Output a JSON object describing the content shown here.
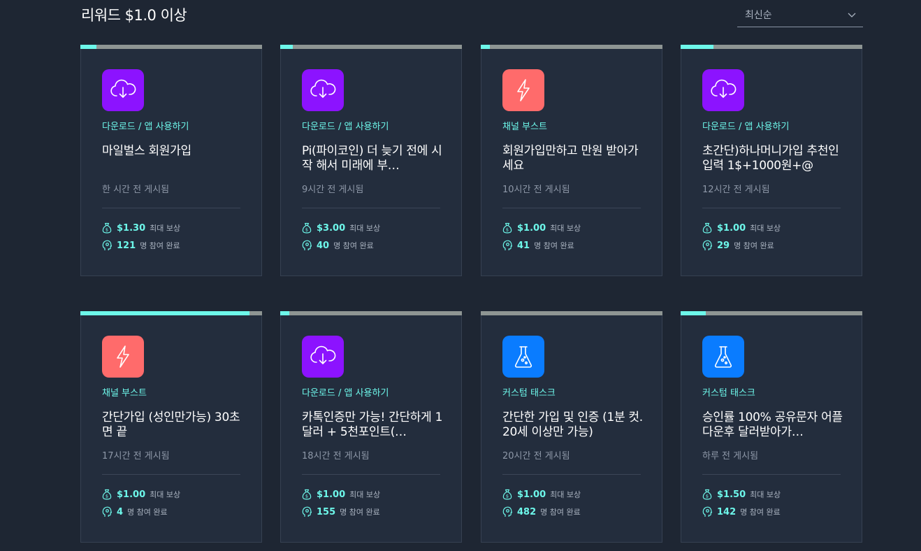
{
  "header": {
    "title": "리워드 $1.0 이상",
    "sort": {
      "selected": "최신순"
    }
  },
  "icons": {
    "download": {
      "name": "cloud-download-icon",
      "color": "#8c13ff"
    },
    "boost": {
      "name": "lightning-icon",
      "color": "#ff6b6b"
    },
    "custom": {
      "name": "flask-icon",
      "color": "#0a7cff"
    }
  },
  "accent_color": "#6df7ea",
  "cards": [
    {
      "icon": "download",
      "category": "다운로드 / 앱 사용하기",
      "title": "마일벌스 회원가입",
      "posted": "한 시간 전 게시됨",
      "reward": "$1.30",
      "reward_label": "최대 보상",
      "participants": "121",
      "participants_label": "명 참여 완료",
      "progress": 0.09
    },
    {
      "icon": "download",
      "category": "다운로드 / 앱 사용하기",
      "title": "Pi(파이코인) 더 늦기 전에 시작 해서 미래에 부…",
      "posted": "9시간 전 게시됨",
      "reward": "$3.00",
      "reward_label": "최대 보상",
      "participants": "40",
      "participants_label": "명 참여 완료",
      "progress": 0.07
    },
    {
      "icon": "boost",
      "category": "채널 부스트",
      "title": "회원가입만하고 만원 받아가세요",
      "posted": "10시간 전 게시됨",
      "reward": "$1.00",
      "reward_label": "최대 보상",
      "participants": "41",
      "participants_label": "명 참여 완료",
      "progress": 0.05
    },
    {
      "icon": "download",
      "category": "다운로드 / 앱 사용하기",
      "title": "초간단)하나머니가입 추천인 입력 1$+1000원+@",
      "posted": "12시간 전 게시됨",
      "reward": "$1.00",
      "reward_label": "최대 보상",
      "participants": "29",
      "participants_label": "명 참여 완료",
      "progress": 0.18
    },
    {
      "icon": "boost",
      "category": "채널 부스트",
      "title": "간단가입 (성인만가능) 30초면 끝",
      "posted": "17시간 전 게시됨",
      "reward": "$1.00",
      "reward_label": "최대 보상",
      "participants": "4",
      "participants_label": "명 참여 완료",
      "progress": 0.93
    },
    {
      "icon": "download",
      "category": "다운로드 / 앱 사용하기",
      "title": "카톡인증만 가능! 간단하게 1달러 + 5천포인트(…",
      "posted": "18시간 전 게시됨",
      "reward": "$1.00",
      "reward_label": "최대 보상",
      "participants": "155",
      "participants_label": "명 참여 완료",
      "progress": 0.05
    },
    {
      "icon": "custom",
      "category": "커스텀 태스크",
      "title": "간단한 가입 및 인증 (1분 컷. 20세 이상만 가능)",
      "posted": "20시간 전 게시됨",
      "reward": "$1.00",
      "reward_label": "최대 보상",
      "participants": "482",
      "participants_label": "명 참여 완료",
      "progress": 0.0
    },
    {
      "icon": "custom",
      "category": "커스텀 태스크",
      "title": "승인률 100% 공유문자 어플다운후 달러받아가…",
      "posted": "하루 전 게시됨",
      "reward": "$1.50",
      "reward_label": "최대 보상",
      "participants": "142",
      "participants_label": "명 참여 완료",
      "progress": 0.14
    }
  ]
}
